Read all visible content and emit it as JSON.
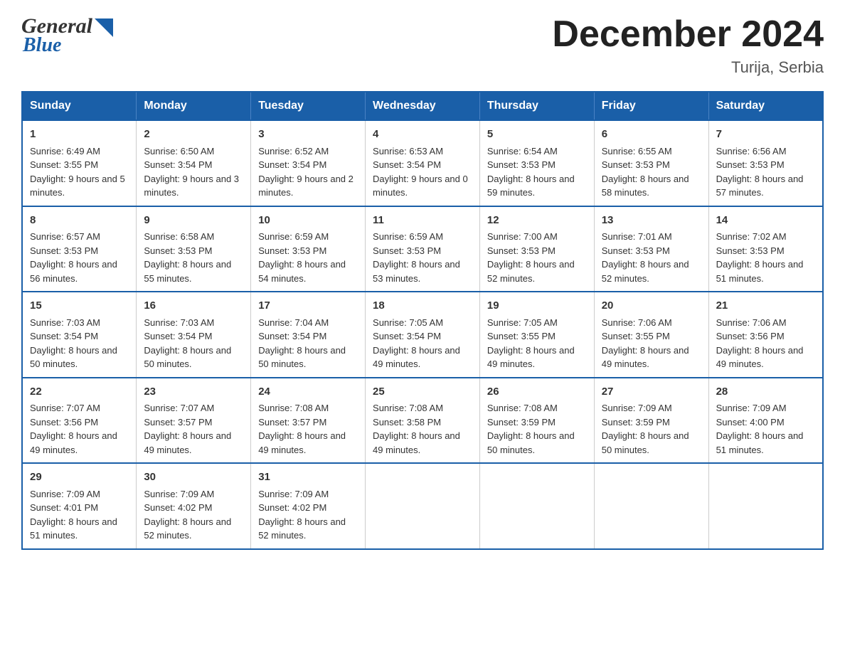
{
  "header": {
    "logo_general": "General",
    "logo_blue": "Blue",
    "main_title": "December 2024",
    "subtitle": "Turija, Serbia"
  },
  "calendar": {
    "days_of_week": [
      "Sunday",
      "Monday",
      "Tuesday",
      "Wednesday",
      "Thursday",
      "Friday",
      "Saturday"
    ],
    "weeks": [
      [
        {
          "date": "1",
          "sunrise": "6:49 AM",
          "sunset": "3:55 PM",
          "daylight": "9 hours and 5 minutes."
        },
        {
          "date": "2",
          "sunrise": "6:50 AM",
          "sunset": "3:54 PM",
          "daylight": "9 hours and 3 minutes."
        },
        {
          "date": "3",
          "sunrise": "6:52 AM",
          "sunset": "3:54 PM",
          "daylight": "9 hours and 2 minutes."
        },
        {
          "date": "4",
          "sunrise": "6:53 AM",
          "sunset": "3:54 PM",
          "daylight": "9 hours and 0 minutes."
        },
        {
          "date": "5",
          "sunrise": "6:54 AM",
          "sunset": "3:53 PM",
          "daylight": "8 hours and 59 minutes."
        },
        {
          "date": "6",
          "sunrise": "6:55 AM",
          "sunset": "3:53 PM",
          "daylight": "8 hours and 58 minutes."
        },
        {
          "date": "7",
          "sunrise": "6:56 AM",
          "sunset": "3:53 PM",
          "daylight": "8 hours and 57 minutes."
        }
      ],
      [
        {
          "date": "8",
          "sunrise": "6:57 AM",
          "sunset": "3:53 PM",
          "daylight": "8 hours and 56 minutes."
        },
        {
          "date": "9",
          "sunrise": "6:58 AM",
          "sunset": "3:53 PM",
          "daylight": "8 hours and 55 minutes."
        },
        {
          "date": "10",
          "sunrise": "6:59 AM",
          "sunset": "3:53 PM",
          "daylight": "8 hours and 54 minutes."
        },
        {
          "date": "11",
          "sunrise": "6:59 AM",
          "sunset": "3:53 PM",
          "daylight": "8 hours and 53 minutes."
        },
        {
          "date": "12",
          "sunrise": "7:00 AM",
          "sunset": "3:53 PM",
          "daylight": "8 hours and 52 minutes."
        },
        {
          "date": "13",
          "sunrise": "7:01 AM",
          "sunset": "3:53 PM",
          "daylight": "8 hours and 52 minutes."
        },
        {
          "date": "14",
          "sunrise": "7:02 AM",
          "sunset": "3:53 PM",
          "daylight": "8 hours and 51 minutes."
        }
      ],
      [
        {
          "date": "15",
          "sunrise": "7:03 AM",
          "sunset": "3:54 PM",
          "daylight": "8 hours and 50 minutes."
        },
        {
          "date": "16",
          "sunrise": "7:03 AM",
          "sunset": "3:54 PM",
          "daylight": "8 hours and 50 minutes."
        },
        {
          "date": "17",
          "sunrise": "7:04 AM",
          "sunset": "3:54 PM",
          "daylight": "8 hours and 50 minutes."
        },
        {
          "date": "18",
          "sunrise": "7:05 AM",
          "sunset": "3:54 PM",
          "daylight": "8 hours and 49 minutes."
        },
        {
          "date": "19",
          "sunrise": "7:05 AM",
          "sunset": "3:55 PM",
          "daylight": "8 hours and 49 minutes."
        },
        {
          "date": "20",
          "sunrise": "7:06 AM",
          "sunset": "3:55 PM",
          "daylight": "8 hours and 49 minutes."
        },
        {
          "date": "21",
          "sunrise": "7:06 AM",
          "sunset": "3:56 PM",
          "daylight": "8 hours and 49 minutes."
        }
      ],
      [
        {
          "date": "22",
          "sunrise": "7:07 AM",
          "sunset": "3:56 PM",
          "daylight": "8 hours and 49 minutes."
        },
        {
          "date": "23",
          "sunrise": "7:07 AM",
          "sunset": "3:57 PM",
          "daylight": "8 hours and 49 minutes."
        },
        {
          "date": "24",
          "sunrise": "7:08 AM",
          "sunset": "3:57 PM",
          "daylight": "8 hours and 49 minutes."
        },
        {
          "date": "25",
          "sunrise": "7:08 AM",
          "sunset": "3:58 PM",
          "daylight": "8 hours and 49 minutes."
        },
        {
          "date": "26",
          "sunrise": "7:08 AM",
          "sunset": "3:59 PM",
          "daylight": "8 hours and 50 minutes."
        },
        {
          "date": "27",
          "sunrise": "7:09 AM",
          "sunset": "3:59 PM",
          "daylight": "8 hours and 50 minutes."
        },
        {
          "date": "28",
          "sunrise": "7:09 AM",
          "sunset": "4:00 PM",
          "daylight": "8 hours and 51 minutes."
        }
      ],
      [
        {
          "date": "29",
          "sunrise": "7:09 AM",
          "sunset": "4:01 PM",
          "daylight": "8 hours and 51 minutes."
        },
        {
          "date": "30",
          "sunrise": "7:09 AM",
          "sunset": "4:02 PM",
          "daylight": "8 hours and 52 minutes."
        },
        {
          "date": "31",
          "sunrise": "7:09 AM",
          "sunset": "4:02 PM",
          "daylight": "8 hours and 52 minutes."
        },
        {
          "date": "",
          "sunrise": "",
          "sunset": "",
          "daylight": ""
        },
        {
          "date": "",
          "sunrise": "",
          "sunset": "",
          "daylight": ""
        },
        {
          "date": "",
          "sunrise": "",
          "sunset": "",
          "daylight": ""
        },
        {
          "date": "",
          "sunrise": "",
          "sunset": "",
          "daylight": ""
        }
      ]
    ]
  }
}
